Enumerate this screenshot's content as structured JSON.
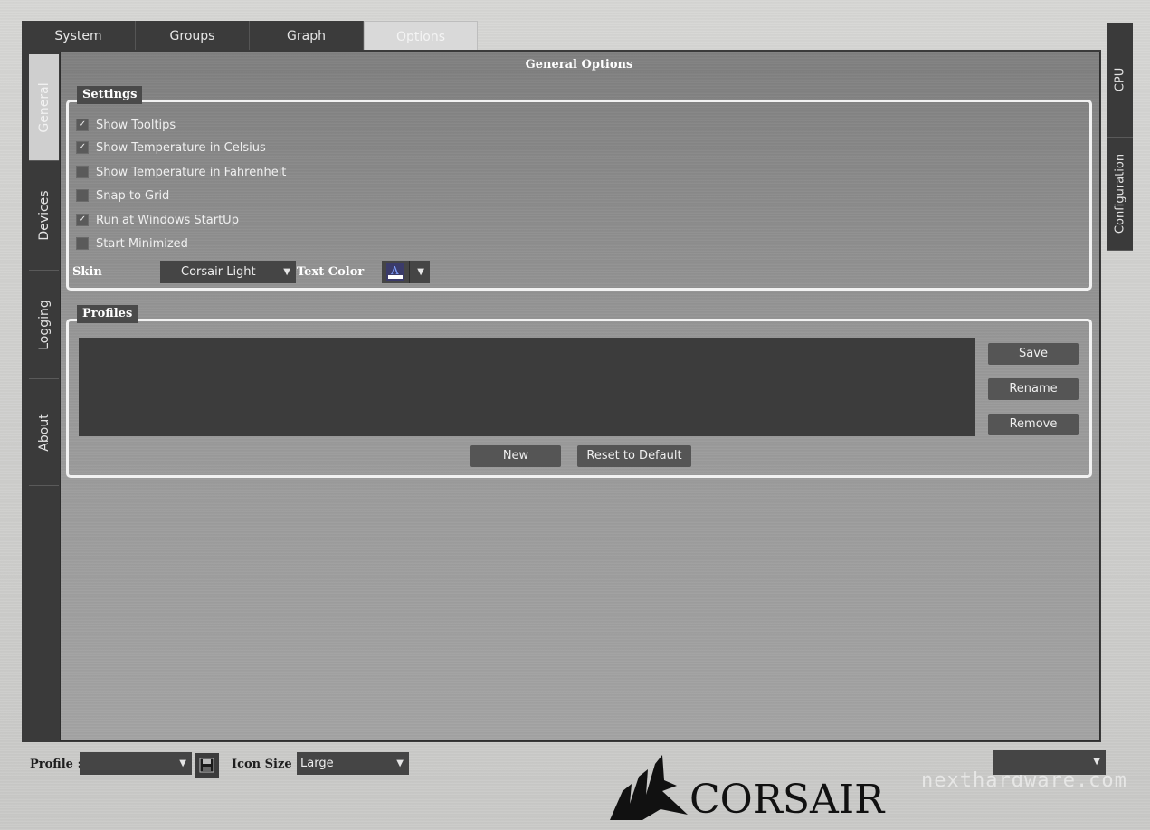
{
  "top_tabs": [
    {
      "label": "System"
    },
    {
      "label": "Groups"
    },
    {
      "label": "Graph"
    },
    {
      "label": "Options"
    }
  ],
  "left_tabs": [
    {
      "label": "General"
    },
    {
      "label": "Devices"
    },
    {
      "label": "Logging"
    },
    {
      "label": "About"
    }
  ],
  "right_tabs": [
    {
      "label": "CPU"
    },
    {
      "label": "Configuration"
    }
  ],
  "panel_title": "General Options",
  "settings": {
    "legend": "Settings",
    "checkboxes": [
      {
        "label": "Show Tooltips",
        "checked": true,
        "mark": "✓"
      },
      {
        "label": "Show Temperature in Celsius",
        "checked": true,
        "mark": "✓"
      },
      {
        "label": "Show Temperature in Fahrenheit",
        "checked": false,
        "mark": ""
      },
      {
        "label": "Snap to Grid",
        "checked": false,
        "mark": ""
      },
      {
        "label": "Run at Windows StartUp",
        "checked": true,
        "mark": "✓"
      },
      {
        "label": "Start Minimized",
        "checked": false,
        "mark": ""
      }
    ],
    "skin_label": "Skin",
    "skin_value": "Corsair Light",
    "text_color_label": "Text Color",
    "text_color_glyph": "A"
  },
  "profiles": {
    "legend": "Profiles",
    "save_label": "Save",
    "rename_label": "Rename",
    "remove_label": "Remove",
    "new_label": "New",
    "reset_label": "Reset to Default"
  },
  "bottom": {
    "profile_label": "Profile :",
    "profile_value": "",
    "icon_size_label": "Icon Size :",
    "icon_size_value": "Large",
    "right_combo_value": ""
  },
  "logo": {
    "text": "CORSAIR"
  },
  "watermark": {
    "text": "nexthardware.com"
  },
  "colors": {
    "accent": "#3a3a3a",
    "panel": "#8f8f8f",
    "frame_light": "#f2f2f2"
  }
}
